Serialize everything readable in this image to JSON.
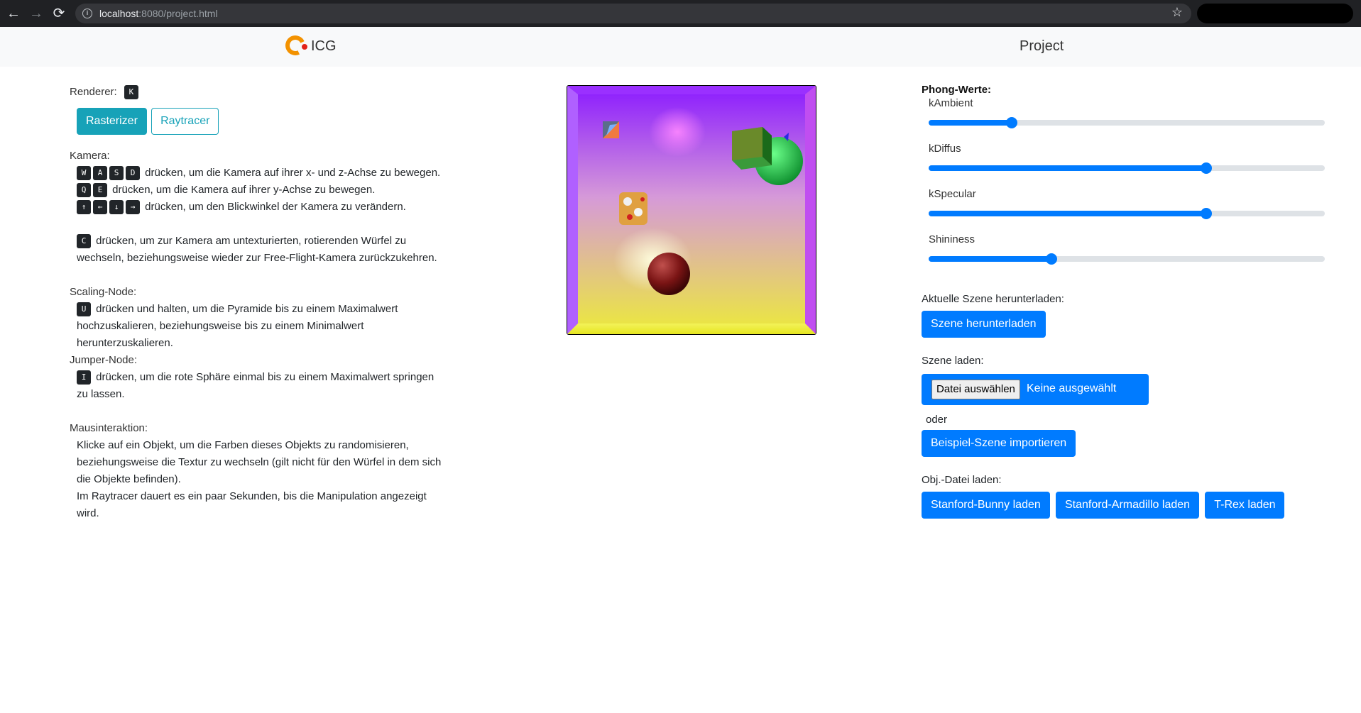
{
  "browser": {
    "url_host": "localhost",
    "url_rest": ":8080/project.html"
  },
  "header": {
    "brand": "ICG",
    "title": "Project"
  },
  "renderer": {
    "label": "Renderer:",
    "key": "K",
    "buttons": [
      "Rasterizer",
      "Raytracer"
    ],
    "active": "Rasterizer"
  },
  "camera": {
    "label": "Kamera:",
    "line1_keys": [
      "W",
      "A",
      "S",
      "D"
    ],
    "line1_text": "drücken, um die Kamera auf ihrer x- und z-Achse zu bewegen.",
    "line2_keys": [
      "Q",
      "E"
    ],
    "line2_text": "drücken, um die Kamera auf ihrer y-Achse zu bewegen.",
    "line3_keys": [
      "↑",
      "←",
      "↓",
      "→"
    ],
    "line3_text": "drücken, um den Blickwinkel der Kamera zu verändern.",
    "switch_key": "C",
    "switch_text_1": "drücken, um zur Kamera am untexturierten, rotierenden Würfel zu",
    "switch_text_2": "wechseln, beziehungsweise wieder zur Free-Flight-Kamera zurückzukehren."
  },
  "scaling": {
    "label": "Scaling-Node:",
    "key": "U",
    "text_1": "drücken und halten, um die Pyramide bis zu einem Maximalwert",
    "text_2": "hochzuskalieren, beziehungsweise bis zu einem Minimalwert",
    "text_3": "herunterzuskalieren."
  },
  "jumper": {
    "label": "Jumper-Node:",
    "key": "I",
    "text_1": "drücken, um die rote Sphäre einmal bis zu einem Maximalwert springen",
    "text_2": "zu lassen."
  },
  "mouse": {
    "label": "Mausinteraktion:",
    "text_1": "Klicke auf ein Objekt, um die Farben dieses Objekts zu randomisieren,",
    "text_2": "beziehungsweise die Textur zu wechseln (gilt nicht für den Würfel in dem sich",
    "text_3": "die Objekte befinden).",
    "text_4": "Im Raytracer dauert es ein paar Sekunden, bis die Manipulation angezeigt",
    "text_5": "wird."
  },
  "phong": {
    "title": "Phong-Werte:",
    "sliders": [
      {
        "label": "kAmbient",
        "value": 0.21
      },
      {
        "label": "kDiffus",
        "value": 0.7
      },
      {
        "label": "kSpecular",
        "value": 0.7
      },
      {
        "label": "Shininess",
        "value": 0.31
      }
    ]
  },
  "download": {
    "label": "Aktuelle Szene herunterladen:",
    "button": "Szene herunterladen"
  },
  "load": {
    "label": "Szene laden:",
    "choose": "Datei auswählen",
    "none": "Keine ausgewählt",
    "or": "oder",
    "example_button": "Beispiel-Szene importieren"
  },
  "obj": {
    "label": "Obj.-Datei laden:",
    "buttons": [
      "Stanford-Bunny laden",
      "Stanford-Armadillo laden",
      "T-Rex laden"
    ]
  },
  "colors": {
    "primary": "#007bff",
    "info": "#17a2b8"
  }
}
